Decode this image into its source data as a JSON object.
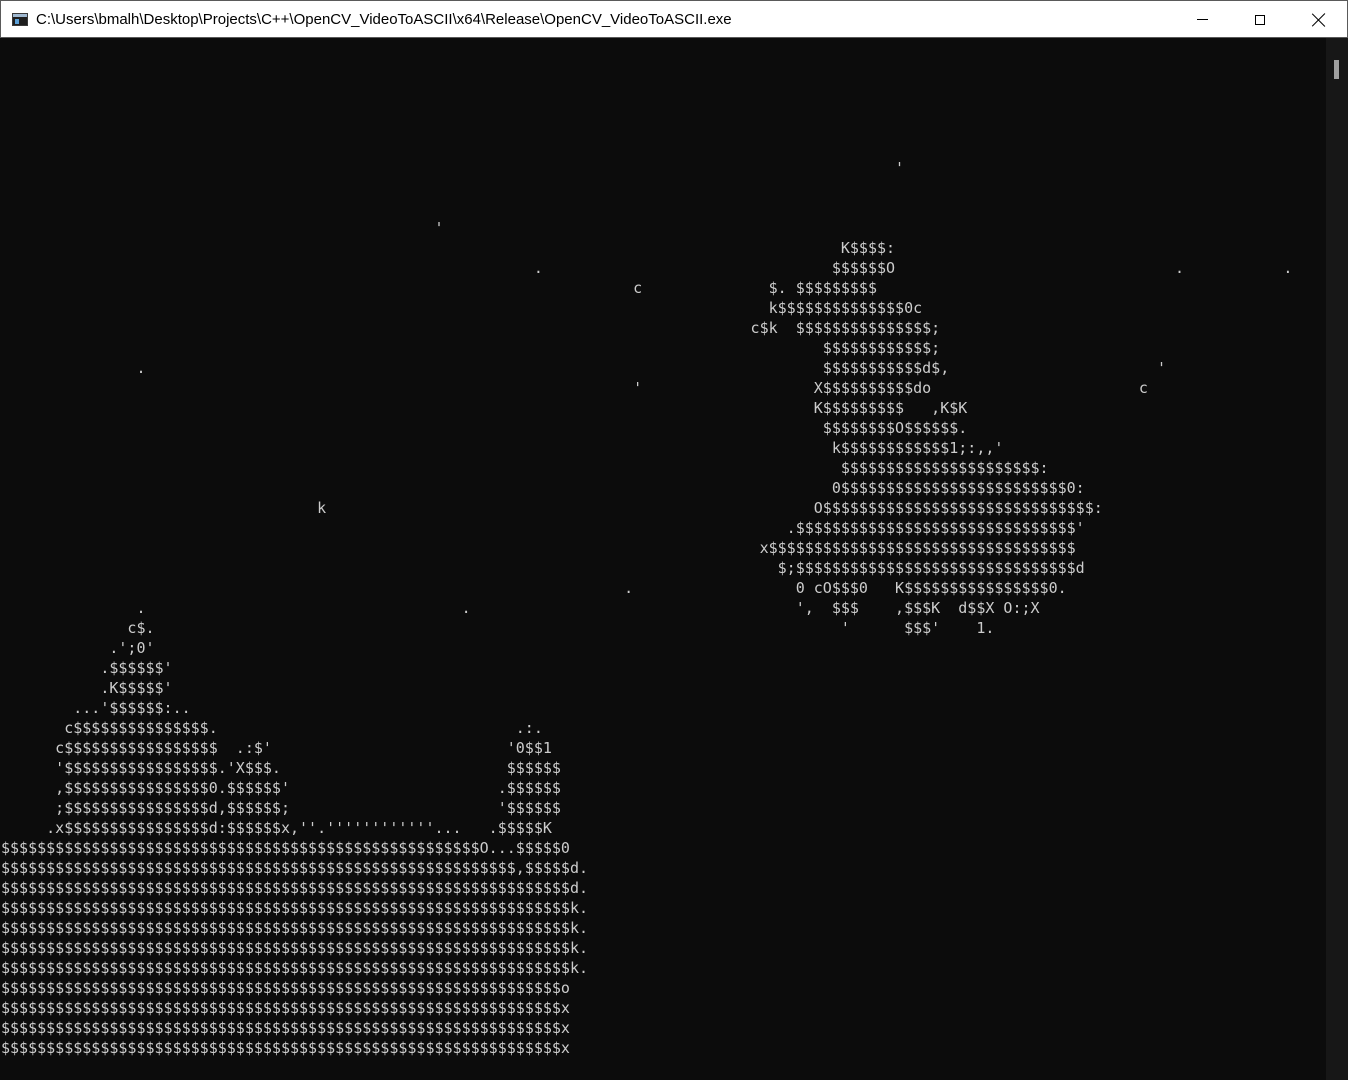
{
  "window": {
    "title": "C:\\Users\\bmalh\\Desktop\\Projects\\C++\\OpenCV_VideoToASCII\\x64\\Release\\OpenCV_VideoToASCII.exe",
    "app_icon": "console-app-icon",
    "controls": {
      "minimize_icon": "minimize-icon",
      "maximize_icon": "maximize-icon",
      "close_icon": "close-icon"
    }
  },
  "console": {
    "background_color": "#0c0c0c",
    "text_color": "#cccccc",
    "output": "\n\n\n\n\n\n                                                                                                   '\n\n\n                                                ' \n                                                                                             K$$$$:\n                                                           .                                $$$$$$O                               .           .\n                                                                      c              $. $$$$$$$$$\n                                                                                     k$$$$$$$$$$$$$$0c\n                                                                                   c$k  $$$$$$$$$$$$$$$;\n                                                                                           $$$$$$$$$$$$;\n               .                                                                           $$$$$$$$$$$d$,                       '\n                                                                      '                   X$$$$$$$$$$do                       c\n                                                                                          K$$$$$$$$$   ,K$K\n                                                                                           $$$$$$$$O$$$$$$.\n                                                                                            k$$$$$$$$$$$$1;:,,'\n                                                                                             $$$$$$$$$$$$$$$$$$$$$$:\n                                                                                            0$$$$$$$$$$$$$$$$$$$$$$$$$0:\n                                   k                                                      O$$$$$$$$$$$$$$$$$$$$$$$$$$$$$$:\n                                                                                       .$$$$$$$$$$$$$$$$$$$$$$$$$$$$$$$'\n                                                                                    x$$$$$$$$$$$$$$$$$$$$$$$$$$$$$$$$$$\n                                                                                      $;$$$$$$$$$$$$$$$$$$$$$$$$$$$$$$$d\n                                                                     .                  0 cO$$$0   K$$$$$$$$$$$$$$$$0.\n               .                                   .                                    ',  $$$    ,$$$K  d$$X O:;X\n              c$.                                                                            '      $$$'    1.\n            .';0'\n           .$$$$$$'\n           .K$$$$$'\n        ...'$$$$$$:..\n       c$$$$$$$$$$$$$$$.                                 .:.\n      c$$$$$$$$$$$$$$$$$  .:$'                          '0$$1\n      '$$$$$$$$$$$$$$$$$.'X$$$.                         $$$$$$\n      ,$$$$$$$$$$$$$$$$0.$$$$$$'                       .$$$$$$\n      ;$$$$$$$$$$$$$$$$d,$$$$$$;                       '$$$$$$\n     .x$$$$$$$$$$$$$$$$d:$$$$$$x,''.''''''''''''...   .$$$$$K\n$$$$$$$$$$$$$$$$$$$$$$$$$$$$$$$$$$$$$$$$$$$$$$$$$$$$$O...$$$$$0\n$$$$$$$$$$$$$$$$$$$$$$$$$$$$$$$$$$$$$$$$$$$$$$$$$$$$$$$$$,$$$$$d.\n$$$$$$$$$$$$$$$$$$$$$$$$$$$$$$$$$$$$$$$$$$$$$$$$$$$$$$$$$$$$$$$d.\n$$$$$$$$$$$$$$$$$$$$$$$$$$$$$$$$$$$$$$$$$$$$$$$$$$$$$$$$$$$$$$$k.\n$$$$$$$$$$$$$$$$$$$$$$$$$$$$$$$$$$$$$$$$$$$$$$$$$$$$$$$$$$$$$$$k.\n$$$$$$$$$$$$$$$$$$$$$$$$$$$$$$$$$$$$$$$$$$$$$$$$$$$$$$$$$$$$$$$k.\n$$$$$$$$$$$$$$$$$$$$$$$$$$$$$$$$$$$$$$$$$$$$$$$$$$$$$$$$$$$$$$$k.\n$$$$$$$$$$$$$$$$$$$$$$$$$$$$$$$$$$$$$$$$$$$$$$$$$$$$$$$$$$$$$$o\n$$$$$$$$$$$$$$$$$$$$$$$$$$$$$$$$$$$$$$$$$$$$$$$$$$$$$$$$$$$$$$x\n$$$$$$$$$$$$$$$$$$$$$$$$$$$$$$$$$$$$$$$$$$$$$$$$$$$$$$$$$$$$$$x\n$$$$$$$$$$$$$$$$$$$$$$$$$$$$$$$$$$$$$$$$$$$$$$$$$$$$$$$$$$$$$$x"
  }
}
